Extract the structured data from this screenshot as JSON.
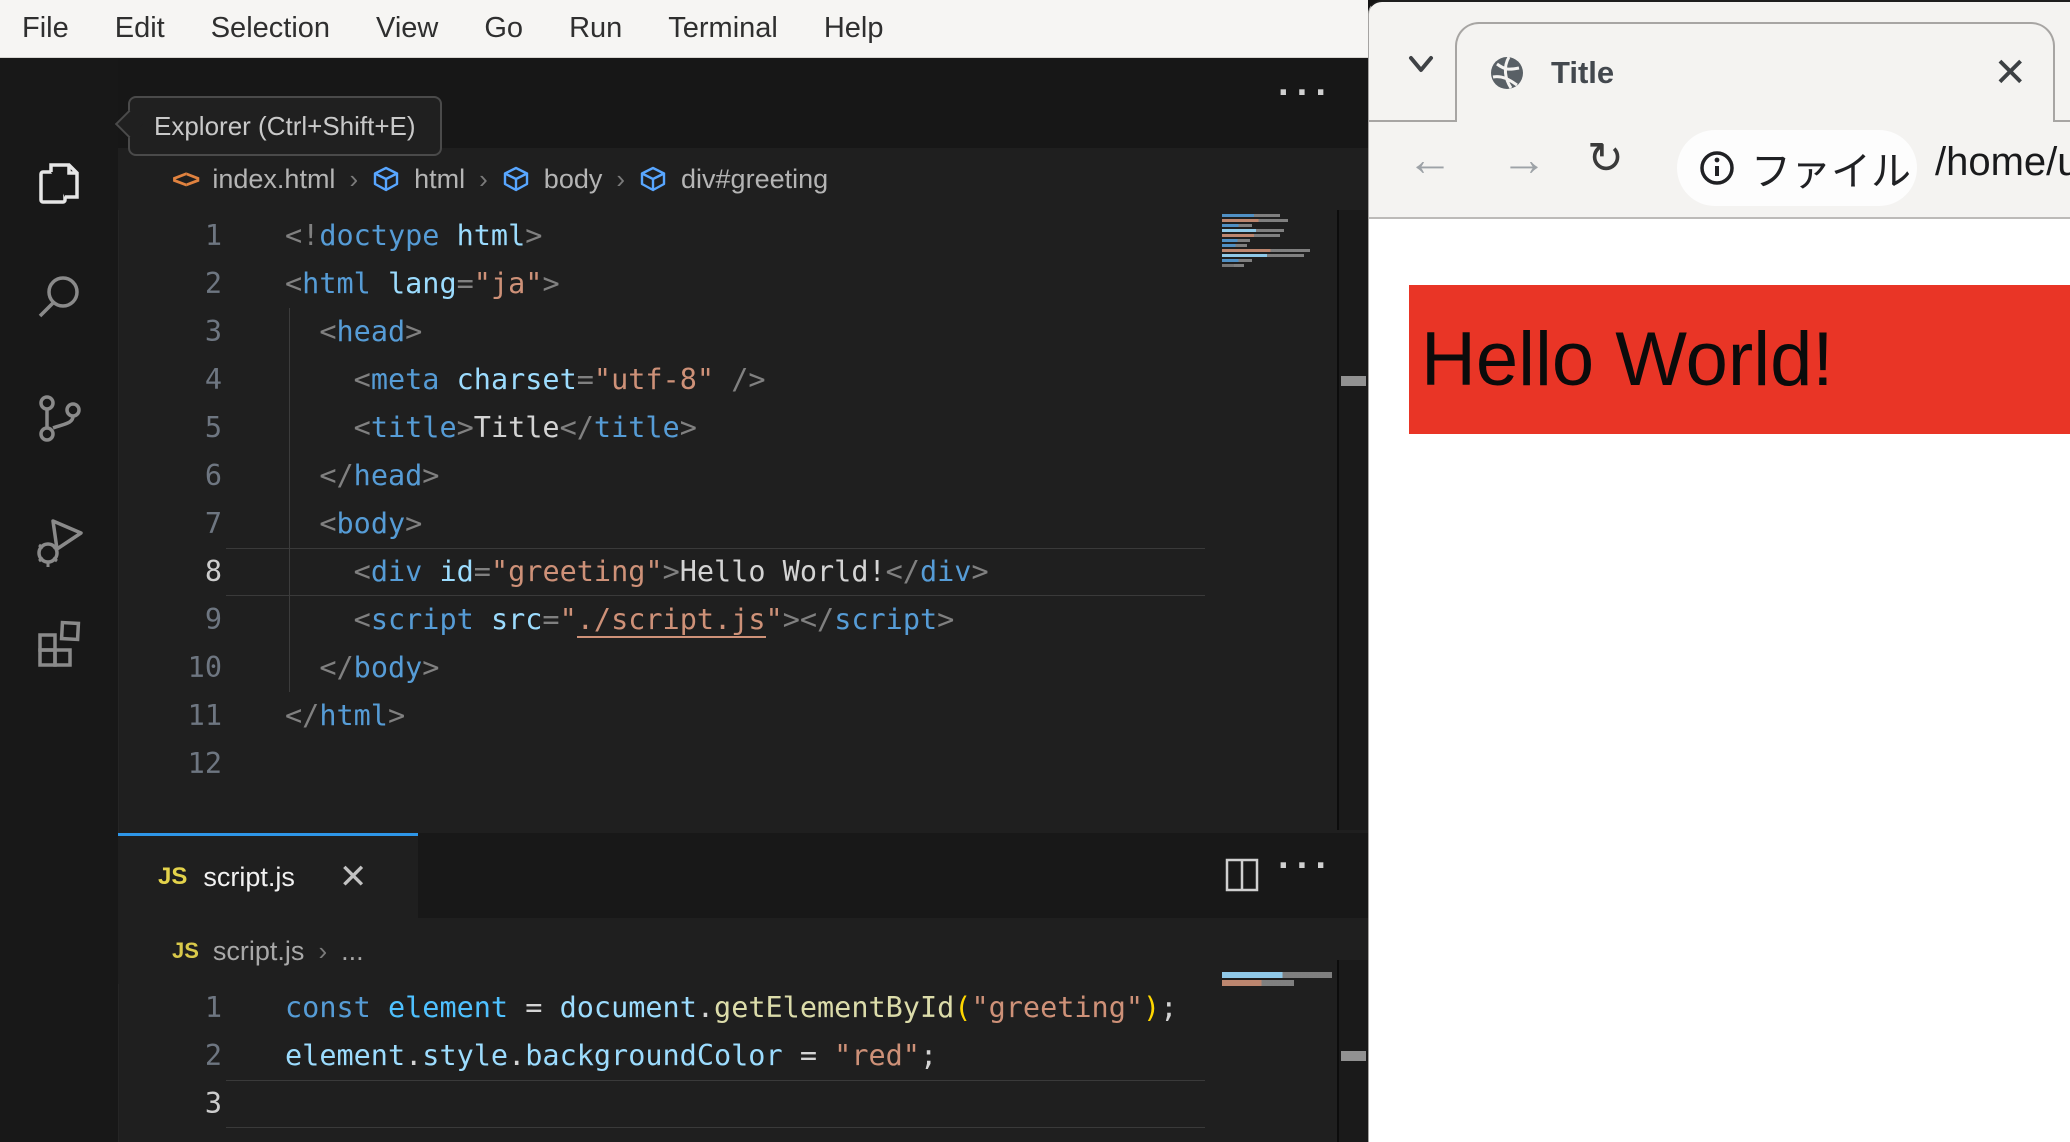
{
  "colors": {
    "accent_blue": "#2e96e8",
    "editor_bg": "#1f1f1f",
    "activity_bar_bg": "#181818",
    "menubar_bg": "#f6f5f3",
    "browser_chrome_bg": "#f4f3f1",
    "red_div": "#e93526",
    "js_badge_yellow": "#e3d24b"
  },
  "vscode": {
    "menubar": {
      "items": [
        "File",
        "Edit",
        "Selection",
        "View",
        "Go",
        "Run",
        "Terminal",
        "Help"
      ]
    },
    "activity_bar": {
      "icons": [
        "explorer-icon",
        "search-icon",
        "source-control-icon",
        "run-debug-icon",
        "extensions-icon"
      ]
    },
    "tooltip": "Explorer (Ctrl+Shift+E)",
    "editor_html": {
      "more_actions": "···",
      "breadcrumb": {
        "items": [
          {
            "icon": "code-icon",
            "label": "index.html"
          },
          {
            "icon": "cube-icon",
            "label": "html"
          },
          {
            "icon": "cube-icon",
            "label": "body"
          },
          {
            "icon": "cube-icon",
            "label": "div#greeting"
          }
        ],
        "separator": "›"
      },
      "current_line": 8,
      "lines": [
        [
          [
            "<!",
            "p"
          ],
          [
            "doctype",
            "tag"
          ],
          [
            " html",
            "attr"
          ],
          [
            ">",
            "p"
          ]
        ],
        [
          [
            "<",
            "p"
          ],
          [
            "html",
            "tag"
          ],
          [
            " ",
            "txt"
          ],
          [
            "lang",
            "attr"
          ],
          [
            "=",
            "p"
          ],
          [
            "\"ja\"",
            "str"
          ],
          [
            ">",
            "p"
          ]
        ],
        [
          [
            "  ",
            "txt"
          ],
          [
            "<",
            "p"
          ],
          [
            "head",
            "tag"
          ],
          [
            ">",
            "p"
          ]
        ],
        [
          [
            "    ",
            "txt"
          ],
          [
            "<",
            "p"
          ],
          [
            "meta",
            "tag"
          ],
          [
            " ",
            "txt"
          ],
          [
            "charset",
            "attr"
          ],
          [
            "=",
            "p"
          ],
          [
            "\"utf-8\"",
            "str"
          ],
          [
            " ",
            "txt"
          ],
          [
            "/>",
            "p"
          ]
        ],
        [
          [
            "    ",
            "txt"
          ],
          [
            "<",
            "p"
          ],
          [
            "title",
            "tag"
          ],
          [
            ">",
            "p"
          ],
          [
            "Title",
            "txt"
          ],
          [
            "</",
            "p"
          ],
          [
            "title",
            "tag"
          ],
          [
            ">",
            "p"
          ]
        ],
        [
          [
            "  ",
            "txt"
          ],
          [
            "</",
            "p"
          ],
          [
            "head",
            "tag"
          ],
          [
            ">",
            "p"
          ]
        ],
        [
          [
            "  ",
            "txt"
          ],
          [
            "<",
            "p"
          ],
          [
            "body",
            "tag"
          ],
          [
            ">",
            "p"
          ]
        ],
        [
          [
            "    ",
            "txt"
          ],
          [
            "<",
            "p"
          ],
          [
            "div",
            "tag"
          ],
          [
            " ",
            "txt"
          ],
          [
            "id",
            "attr"
          ],
          [
            "=",
            "p"
          ],
          [
            "\"greeting\"",
            "str"
          ],
          [
            ">",
            "p"
          ],
          [
            "Hello World!",
            "txt"
          ],
          [
            "</",
            "p"
          ],
          [
            "div",
            "tag"
          ],
          [
            ">",
            "p"
          ]
        ],
        [
          [
            "    ",
            "txt"
          ],
          [
            "<",
            "p"
          ],
          [
            "script",
            "tag"
          ],
          [
            " ",
            "txt"
          ],
          [
            "src",
            "attr"
          ],
          [
            "=",
            "p"
          ],
          [
            "\"",
            "str"
          ],
          [
            "./script.js",
            "link"
          ],
          [
            "\"",
            "str"
          ],
          [
            ">",
            "p"
          ],
          [
            "</",
            "p"
          ],
          [
            "script",
            "tag"
          ],
          [
            ">",
            "p"
          ]
        ],
        [
          [
            "  ",
            "txt"
          ],
          [
            "</",
            "p"
          ],
          [
            "body",
            "tag"
          ],
          [
            ">",
            "p"
          ]
        ],
        [
          [
            "</",
            "p"
          ],
          [
            "html",
            "tag"
          ],
          [
            ">",
            "p"
          ]
        ],
        []
      ]
    },
    "editor_js": {
      "tab": {
        "badge": "JS",
        "label": "script.js",
        "close": "✕"
      },
      "more_actions": "···",
      "breadcrumb": {
        "badge": "JS",
        "file": "script.js",
        "separator": "›",
        "more": "..."
      },
      "current_line": 3,
      "lines": [
        [
          [
            "const",
            "kw"
          ],
          [
            " ",
            "txt"
          ],
          [
            "element",
            "var2"
          ],
          [
            " ",
            "txt"
          ],
          [
            "=",
            "op"
          ],
          [
            " ",
            "txt"
          ],
          [
            "document",
            "var"
          ],
          [
            ".",
            "op"
          ],
          [
            "getElementById",
            "fn"
          ],
          [
            "(",
            "par"
          ],
          [
            "\"greeting\"",
            "str"
          ],
          [
            ")",
            "par"
          ],
          [
            ";",
            "op"
          ]
        ],
        [
          [
            "element",
            "var"
          ],
          [
            ".",
            "op"
          ],
          [
            "style",
            "var"
          ],
          [
            ".",
            "op"
          ],
          [
            "backgroundColor",
            "var"
          ],
          [
            " ",
            "txt"
          ],
          [
            "=",
            "op"
          ],
          [
            " ",
            "txt"
          ],
          [
            "\"red\"",
            "str"
          ],
          [
            ";",
            "op"
          ]
        ],
        []
      ]
    }
  },
  "browser": {
    "tab": {
      "title": "Title",
      "close": "✕"
    },
    "toolbar": {
      "back_icon": "←",
      "forward_icon": "→",
      "reload_icon": "↻",
      "chip_label": "ファイル",
      "url": "/home/u"
    },
    "content": {
      "text": "Hello World!"
    }
  }
}
